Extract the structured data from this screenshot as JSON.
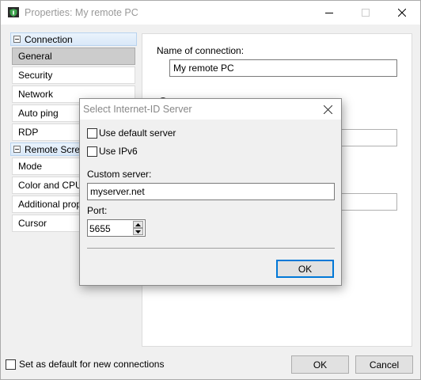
{
  "window": {
    "title": "Properties: My remote PC",
    "icon": "shield-app-icon"
  },
  "sidebar": {
    "groups": [
      {
        "label": "Connection",
        "items": [
          {
            "label": "General",
            "selected": true
          },
          {
            "label": "Security"
          },
          {
            "label": "Network"
          },
          {
            "label": "Auto ping"
          },
          {
            "label": "RDP"
          }
        ]
      },
      {
        "label": "Remote Screen",
        "items": [
          {
            "label": "Mode"
          },
          {
            "label": "Color and CPU"
          },
          {
            "label": "Additional properties"
          },
          {
            "label": "Cursor"
          }
        ]
      }
    ]
  },
  "panel": {
    "name_label": "Name of connection:",
    "name_value": "My remote PC"
  },
  "footer": {
    "default_checkbox_label": "Set as default for new connections",
    "default_checked": false,
    "ok_label": "OK",
    "cancel_label": "Cancel"
  },
  "dialog": {
    "title": "Select Internet-ID Server",
    "use_default_label": "Use default server",
    "use_default_checked": false,
    "use_ipv6_label": "Use IPv6",
    "use_ipv6_checked": false,
    "custom_server_label": "Custom server:",
    "custom_server_value": "myserver.net",
    "port_label": "Port:",
    "port_value": "5655",
    "ok_label": "OK"
  },
  "colors": {
    "accent": "#0078d7",
    "selected_item": "#cccccc",
    "group_header": "#d9e8f8"
  }
}
